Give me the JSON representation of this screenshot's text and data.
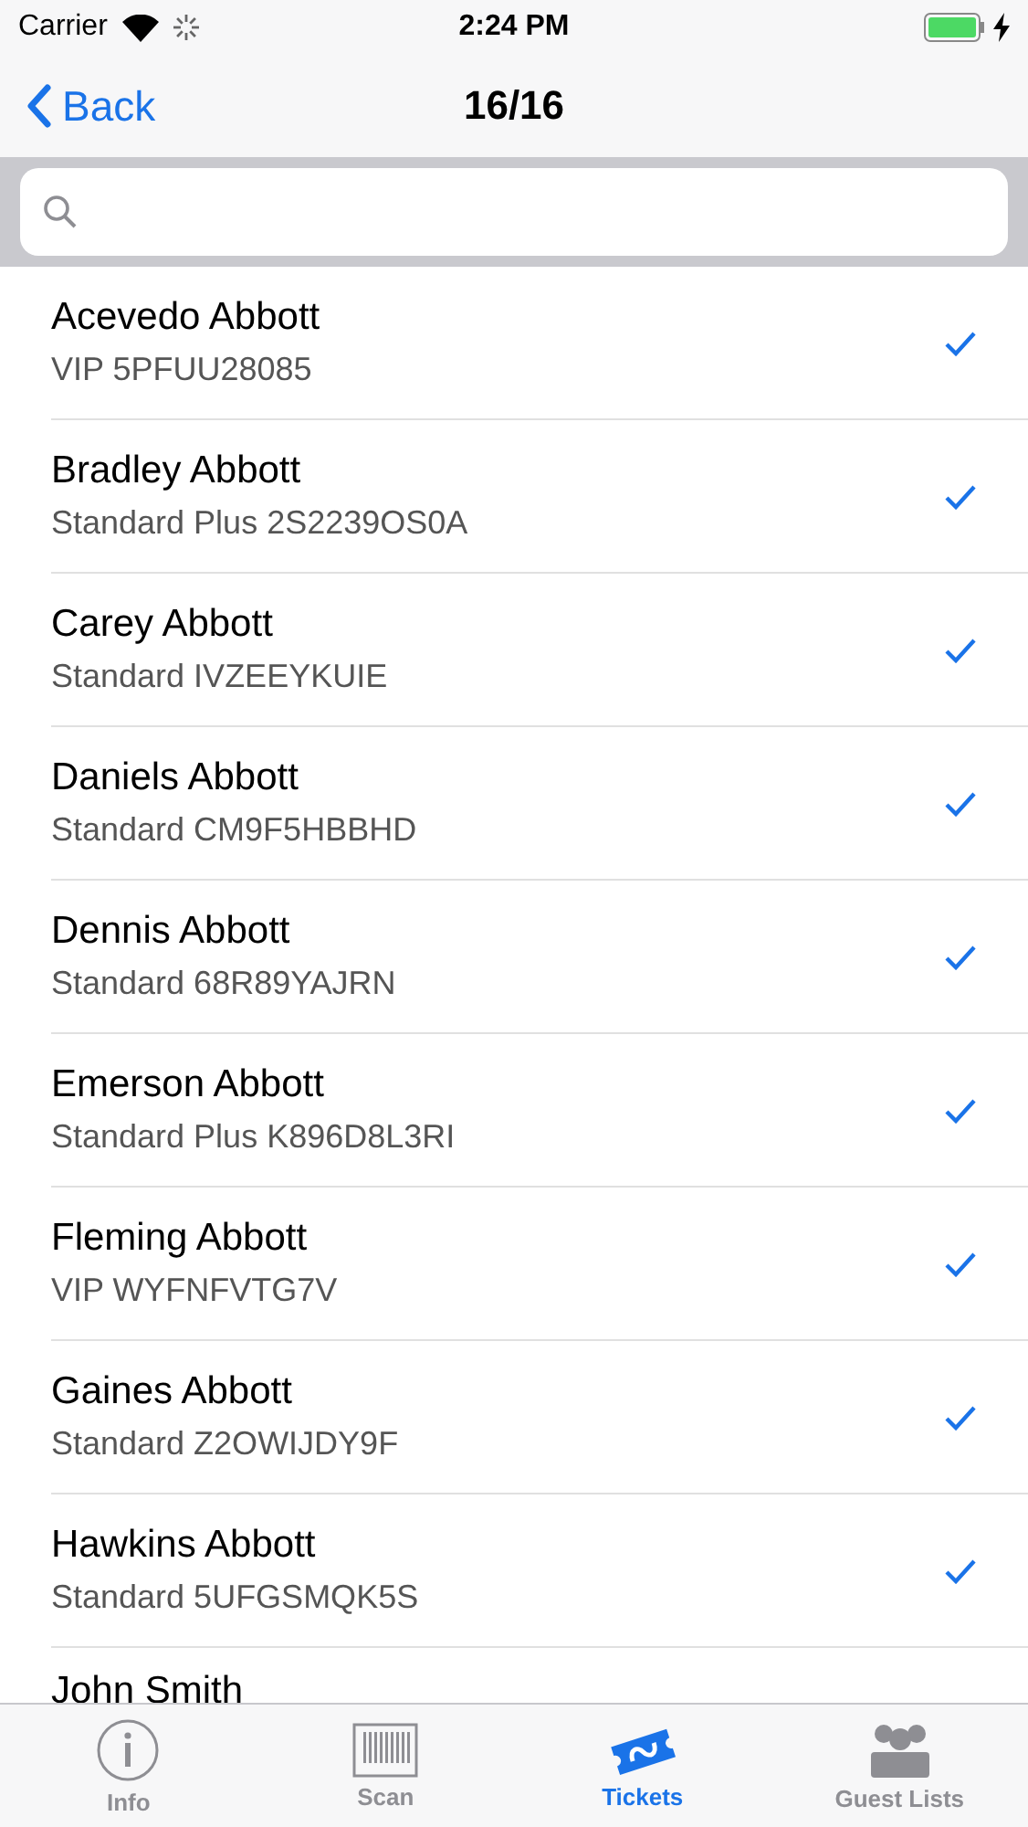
{
  "status_bar": {
    "carrier": "Carrier",
    "time": "2:24 PM"
  },
  "nav_bar": {
    "back": "Back",
    "title": "16/16"
  },
  "tickets": [
    {
      "name": "Acevedo Abbott",
      "detail": "VIP 5PFUU28085",
      "checked": true
    },
    {
      "name": "Bradley Abbott",
      "detail": "Standard Plus 2S2239OS0A",
      "checked": true
    },
    {
      "name": "Carey Abbott",
      "detail": "Standard IVZEEYKUIE",
      "checked": true
    },
    {
      "name": "Daniels Abbott",
      "detail": "Standard CM9F5HBBHD",
      "checked": true
    },
    {
      "name": "Dennis Abbott",
      "detail": "Standard 68R89YAJRN",
      "checked": true
    },
    {
      "name": "Emerson Abbott",
      "detail": "Standard Plus K896D8L3RI",
      "checked": true
    },
    {
      "name": "Fleming Abbott",
      "detail": "VIP WYFNFVTG7V",
      "checked": true
    },
    {
      "name": "Gaines Abbott",
      "detail": "Standard Z2OWIJDY9F",
      "checked": true
    },
    {
      "name": "Hawkins Abbott",
      "detail": "Standard 5UFGSMQK5S",
      "checked": true
    },
    {
      "name": "John Smith"
    }
  ],
  "tab_bar": [
    {
      "label": "Info",
      "kind": "info",
      "selected": false
    },
    {
      "label": "Scan",
      "kind": "scan",
      "selected": false
    },
    {
      "label": "Tickets",
      "kind": "tickets",
      "selected": true
    },
    {
      "label": "Guest Lists",
      "kind": "guests",
      "selected": false
    }
  ]
}
